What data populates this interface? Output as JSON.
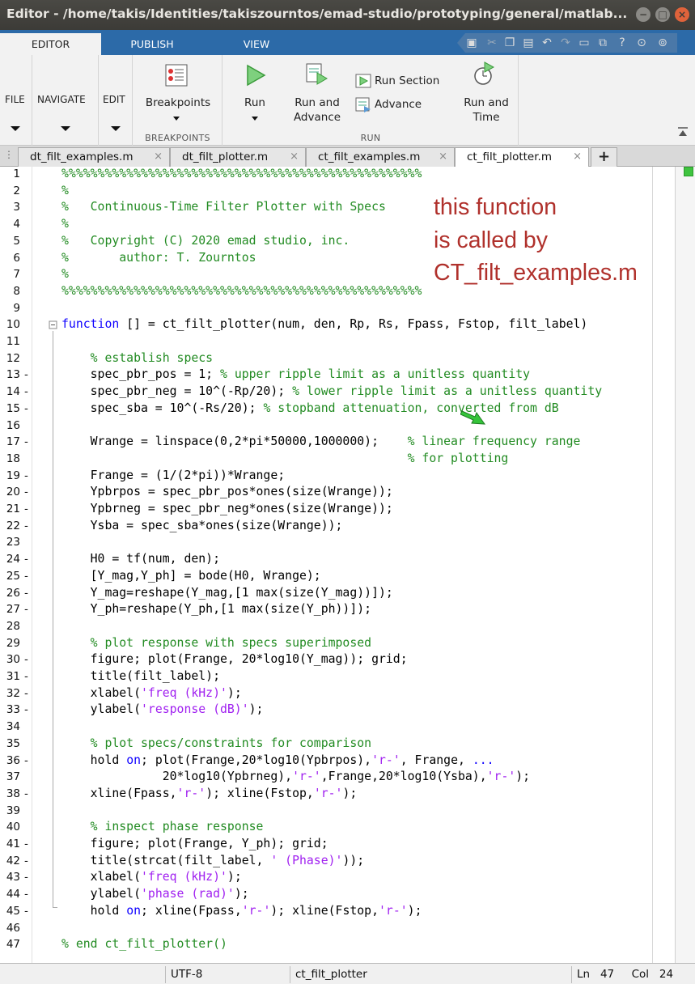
{
  "window": {
    "title": "Editor - /home/takis/Identities/takiszourntos/emad-studio/prototyping/general/matlab..."
  },
  "ribbon_tabs": [
    "EDITOR",
    "PUBLISH",
    "VIEW"
  ],
  "ribbon": {
    "file": "FILE",
    "navigate": "NAVIGATE",
    "edit": "EDIT",
    "breakpoints": "Breakpoints",
    "breakpoints_group": "BREAKPOINTS",
    "run": "Run",
    "run_and_advance": "Run and\nAdvance",
    "run_section": "Run Section",
    "advance": "Advance",
    "run_and_time": "Run and\nTime",
    "run_group": "RUN"
  },
  "file_tabs": [
    "dt_filt_examples.m",
    "dt_filt_plotter.m",
    "ct_filt_examples.m",
    "ct_filt_plotter.m"
  ],
  "active_file_tab": 3,
  "annotation": [
    "this function",
    "is called by",
    "CT_filt_examples.m"
  ],
  "code_lines": [
    {
      "n": "1",
      "d": "",
      "html": "<span class=\"cm\">%%%%%%%%%%%%%%%%%%%%%%%%%%%%%%%%%%%%%%%%%%%%%%%%%%</span>"
    },
    {
      "n": "2",
      "d": "",
      "html": "<span class=\"cm\">%</span>"
    },
    {
      "n": "3",
      "d": "",
      "html": "<span class=\"cm\">%   Continuous-Time Filter Plotter with Specs</span>"
    },
    {
      "n": "4",
      "d": "",
      "html": "<span class=\"cm\">%</span>"
    },
    {
      "n": "5",
      "d": "",
      "html": "<span class=\"cm\">%   Copyright (C) 2020 emad studio, inc.</span>"
    },
    {
      "n": "6",
      "d": "",
      "html": "<span class=\"cm\">%       author: T. Zourntos</span>"
    },
    {
      "n": "7",
      "d": "",
      "html": "<span class=\"cm\">%</span>"
    },
    {
      "n": "8",
      "d": "",
      "html": "<span class=\"cm\">%%%%%%%%%%%%%%%%%%%%%%%%%%%%%%%%%%%%%%%%%%%%%%%%%%</span>"
    },
    {
      "n": "9",
      "d": "",
      "html": ""
    },
    {
      "n": "10",
      "d": "",
      "html": "<span class=\"kw\">function</span> [] = ct_filt_plotter(num, den, Rp, Rs, Fpass, Fstop, filt_label)"
    },
    {
      "n": "11",
      "d": "",
      "html": ""
    },
    {
      "n": "12",
      "d": "",
      "html": "    <span class=\"cm\">% establish specs</span>"
    },
    {
      "n": "13",
      "d": "-",
      "html": "    spec_pbr_pos = 1; <span class=\"cm\">% upper ripple limit as a unitless quantity</span>"
    },
    {
      "n": "14",
      "d": "-",
      "html": "    spec_pbr_neg = 10^(-Rp/20); <span class=\"cm\">% lower ripple limit as a unitless quantity</span>"
    },
    {
      "n": "15",
      "d": "-",
      "html": "    spec_sba = 10^(-Rs/20); <span class=\"cm\">% stopband attenuation, converted from dB</span>"
    },
    {
      "n": "16",
      "d": "",
      "html": ""
    },
    {
      "n": "17",
      "d": "-",
      "html": "    Wrange = linspace(0,2*pi*50000,1000000);    <span class=\"cm\">% linear frequency range</span>"
    },
    {
      "n": "18",
      "d": "",
      "html": "                                                <span class=\"cm\">% for plotting</span>"
    },
    {
      "n": "19",
      "d": "-",
      "html": "    Frange = (1/(2*pi))*Wrange;"
    },
    {
      "n": "20",
      "d": "-",
      "html": "    Ypbrpos = spec_pbr_pos*ones(size(Wrange));"
    },
    {
      "n": "21",
      "d": "-",
      "html": "    Ypbrneg = spec_pbr_neg*ones(size(Wrange));"
    },
    {
      "n": "22",
      "d": "-",
      "html": "    Ysba = spec_sba*ones(size(Wrange));"
    },
    {
      "n": "23",
      "d": "",
      "html": ""
    },
    {
      "n": "24",
      "d": "-",
      "html": "    H0 = tf(num, den);"
    },
    {
      "n": "25",
      "d": "-",
      "html": "    [Y_mag,Y_ph] = bode(H0, Wrange);"
    },
    {
      "n": "26",
      "d": "-",
      "html": "    Y_mag=reshape(Y_mag,[1 max(size(Y_mag))]);"
    },
    {
      "n": "27",
      "d": "-",
      "html": "    Y_ph=reshape(Y_ph,[1 max(size(Y_ph))]);"
    },
    {
      "n": "28",
      "d": "",
      "html": ""
    },
    {
      "n": "29",
      "d": "",
      "html": "    <span class=\"cm\">% plot response with specs superimposed</span>"
    },
    {
      "n": "30",
      "d": "-",
      "html": "    figure; plot(Frange, 20*log10(Y_mag)); grid;"
    },
    {
      "n": "31",
      "d": "-",
      "html": "    title(filt_label);"
    },
    {
      "n": "32",
      "d": "-",
      "html": "    xlabel(<span class=\"str\">'freq (kHz)'</span>);"
    },
    {
      "n": "33",
      "d": "-",
      "html": "    ylabel(<span class=\"str\">'response (dB)'</span>);"
    },
    {
      "n": "34",
      "d": "",
      "html": ""
    },
    {
      "n": "35",
      "d": "",
      "html": "    <span class=\"cm\">% plot specs/constraints for comparison</span>"
    },
    {
      "n": "36",
      "d": "-",
      "html": "    hold <span class=\"kw\">on</span>; plot(Frange,20*log10(Ypbrpos),<span class=\"str\">'r-'</span>, Frange, <span class=\"kw\">...</span>"
    },
    {
      "n": "37",
      "d": "",
      "html": "              20*log10(Ypbrneg),<span class=\"str\">'r-'</span>,Frange,20*log10(Ysba),<span class=\"str\">'r-'</span>);"
    },
    {
      "n": "38",
      "d": "-",
      "html": "    xline(Fpass,<span class=\"str\">'r-'</span>); xline(Fstop,<span class=\"str\">'r-'</span>);"
    },
    {
      "n": "39",
      "d": "",
      "html": ""
    },
    {
      "n": "40",
      "d": "",
      "html": "    <span class=\"cm\">% inspect phase response</span>"
    },
    {
      "n": "41",
      "d": "-",
      "html": "    figure; plot(Frange, Y_ph); grid;"
    },
    {
      "n": "42",
      "d": "-",
      "html": "    title(strcat(filt_label, <span class=\"str\">' (Phase)'</span>));"
    },
    {
      "n": "43",
      "d": "-",
      "html": "    xlabel(<span class=\"str\">'freq (kHz)'</span>);"
    },
    {
      "n": "44",
      "d": "-",
      "html": "    ylabel(<span class=\"str\">'phase (rad)'</span>);"
    },
    {
      "n": "45",
      "d": "-",
      "html": "    hold <span class=\"kw\">on</span>; xline(Fpass,<span class=\"str\">'r-'</span>); xline(Fstop,<span class=\"str\">'r-'</span>);"
    },
    {
      "n": "46",
      "d": "",
      "html": ""
    },
    {
      "n": "47",
      "d": "",
      "html": "<span class=\"cm\">% end ct_filt_plotter()</span>"
    }
  ],
  "status": {
    "encoding": "UTF-8",
    "function": "ct_filt_plotter",
    "ln_label": "Ln",
    "ln": "47",
    "col_label": "Col",
    "col": "24"
  },
  "colors": {
    "title_bar": "#3c3b37",
    "ribbon_tab_bar": "#2c6aa8",
    "comment": "#228b22",
    "keyword": "#0e00ff",
    "string": "#a020f0",
    "annotation": "#b0312c"
  }
}
